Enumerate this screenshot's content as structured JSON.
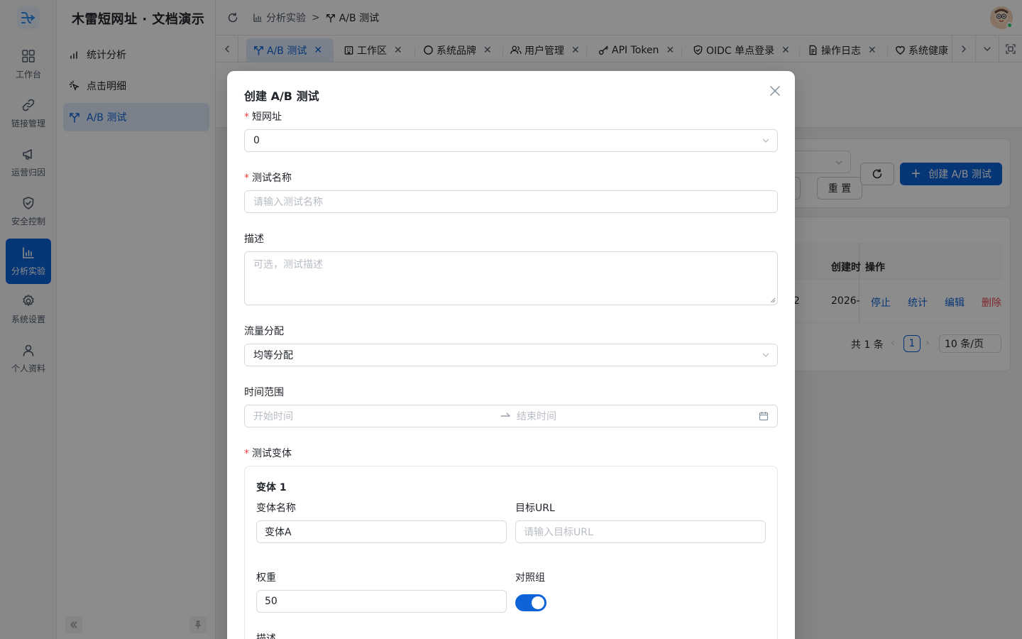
{
  "rail": {
    "items": [
      {
        "label": "工作台",
        "icon": "dashboard-icon"
      },
      {
        "label": "链接管理",
        "icon": "link-icon"
      },
      {
        "label": "运营归因",
        "icon": "megaphone-icon"
      },
      {
        "label": "安全控制",
        "icon": "shield-icon"
      },
      {
        "label": "分析实验",
        "icon": "bar-chart-icon",
        "active": true
      },
      {
        "label": "系统设置",
        "icon": "gear-icon"
      },
      {
        "label": "个人资料",
        "icon": "user-icon"
      }
    ]
  },
  "menu": {
    "title": "木雷短网址 · 文档演示",
    "items": [
      {
        "label": "统计分析",
        "icon": "stats-icon"
      },
      {
        "label": "点击明细",
        "icon": "click-icon"
      },
      {
        "label": "A/B 测试",
        "icon": "split-icon",
        "active": true
      }
    ]
  },
  "header": {
    "breadcrumb": [
      "分析实验",
      "A/B 测试"
    ]
  },
  "tabs": [
    {
      "label": "A/B 测试",
      "active": true
    },
    {
      "label": "工作区"
    },
    {
      "label": "系统品牌"
    },
    {
      "label": "用户管理"
    },
    {
      "label": "API Token"
    },
    {
      "label": "OIDC 单点登录"
    },
    {
      "label": "操作日志"
    },
    {
      "label": "系统健康"
    }
  ],
  "background": {
    "reset_label": "重 置",
    "create_label": "创建 A/B 测试",
    "table": {
      "col_created": "创建时",
      "col_actions": "操作",
      "row_partial": "2",
      "row_created": "2026-",
      "actions": [
        "停止",
        "统计",
        "编辑",
        "删除"
      ]
    },
    "pagination": {
      "total": "共 1 条",
      "page": "1",
      "page_size": "10 条/页"
    }
  },
  "modal": {
    "title": "创建 A/B 测试",
    "short_url": {
      "label": "短网址",
      "value": "0"
    },
    "test_name": {
      "label": "测试名称",
      "placeholder": "请输入测试名称"
    },
    "description": {
      "label": "描述",
      "placeholder": "可选，测试描述"
    },
    "traffic": {
      "label": "流量分配",
      "value": "均等分配"
    },
    "time_range": {
      "label": "时间范围",
      "start_placeholder": "开始时间",
      "end_placeholder": "结束时间"
    },
    "variants": {
      "label": "测试变体",
      "items": [
        {
          "title": "变体 1",
          "name_label": "变体名称",
          "name_value": "变体A",
          "url_label": "目标URL",
          "url_placeholder": "请输入目标URL",
          "weight_label": "权重",
          "weight_value": "50",
          "control_label": "对照组",
          "control_on": true,
          "desc_label": "描述"
        }
      ]
    }
  },
  "colors": {
    "primary": "#0e63d8",
    "danger": "#e5484d",
    "required": "#f53f3f"
  }
}
